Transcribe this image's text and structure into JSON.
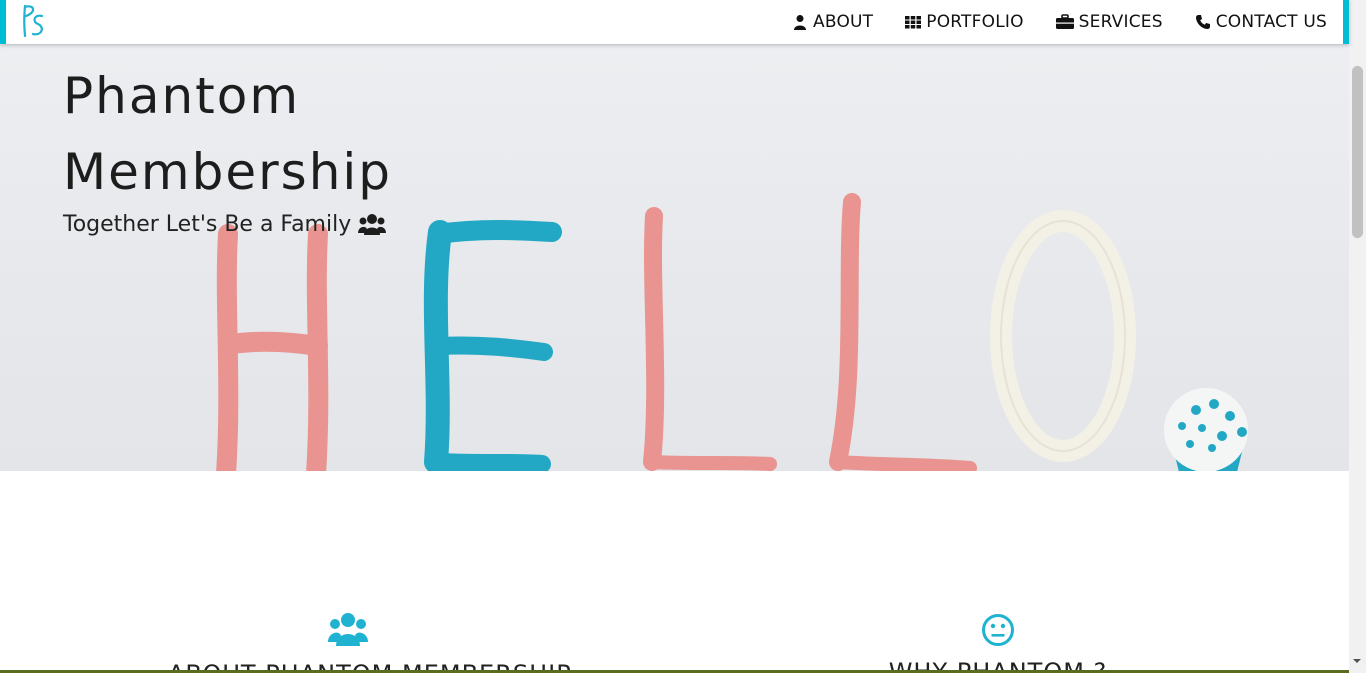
{
  "brand": {
    "logo_text": "PS",
    "accent": "#00bcd4"
  },
  "nav": {
    "items": [
      {
        "label": "ABOUT",
        "icon": "user-icon"
      },
      {
        "label": "PORTFOLIO",
        "icon": "grid-icon"
      },
      {
        "label": "SERVICES",
        "icon": "briefcase-icon"
      },
      {
        "label": "CONTACT US",
        "icon": "phone-icon"
      }
    ]
  },
  "hero": {
    "title_line1": "Phantom",
    "title_line2": "Membership",
    "subtitle": "Together Let's Be a Family",
    "subtitle_icon": "users-icon",
    "image_text": "HELLO"
  },
  "features": [
    {
      "title": "ABOUT PHANTOM MEMBERSHIP",
      "icon": "users-icon",
      "icon_color": "#1fb3d1"
    },
    {
      "title": "WHY PHANTOM ?",
      "icon": "neutral-face-icon",
      "icon_color": "#1fb3d1"
    }
  ]
}
